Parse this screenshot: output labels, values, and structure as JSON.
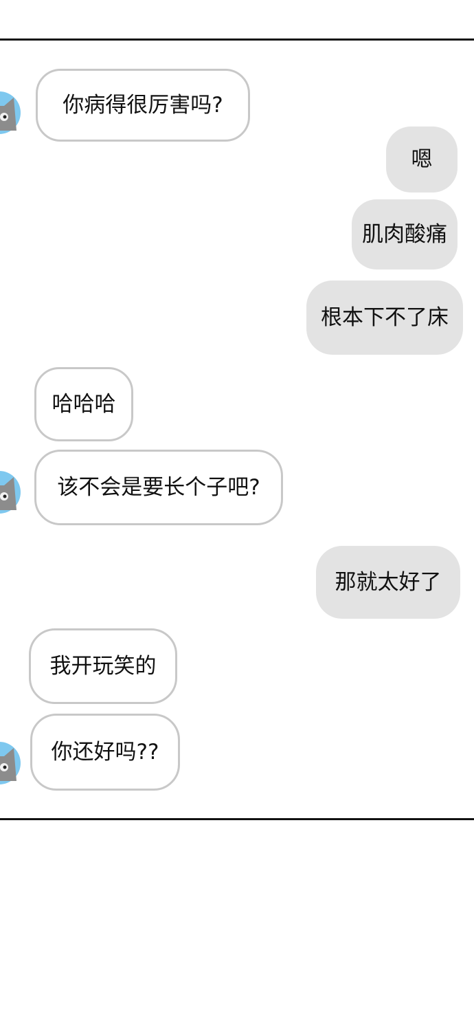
{
  "chat": {
    "messages": [
      {
        "side": "in",
        "text": "你病得很厉害吗?"
      },
      {
        "side": "out",
        "text": "嗯"
      },
      {
        "side": "out",
        "text": "肌肉酸痛"
      },
      {
        "side": "out",
        "text": "根本下不了床"
      },
      {
        "side": "in",
        "text": "哈哈哈"
      },
      {
        "side": "in",
        "text": "该不会是要长个子吧?"
      },
      {
        "side": "out",
        "text": "那就太好了"
      },
      {
        "side": "in",
        "text": "我开玩笑的"
      },
      {
        "side": "in",
        "text": "你还好吗??"
      }
    ]
  },
  "colors": {
    "incoming_bubble_bg": "#ffffff",
    "incoming_bubble_border": "#c8c8c8",
    "outgoing_bubble_bg": "#e3e3e3",
    "text": "#111111",
    "divider": "#111111",
    "avatar_sky": "#7ec8ef",
    "avatar_fur": "#8c8c8c"
  },
  "icons": {
    "avatar": "gray-cat-avatar-icon"
  }
}
